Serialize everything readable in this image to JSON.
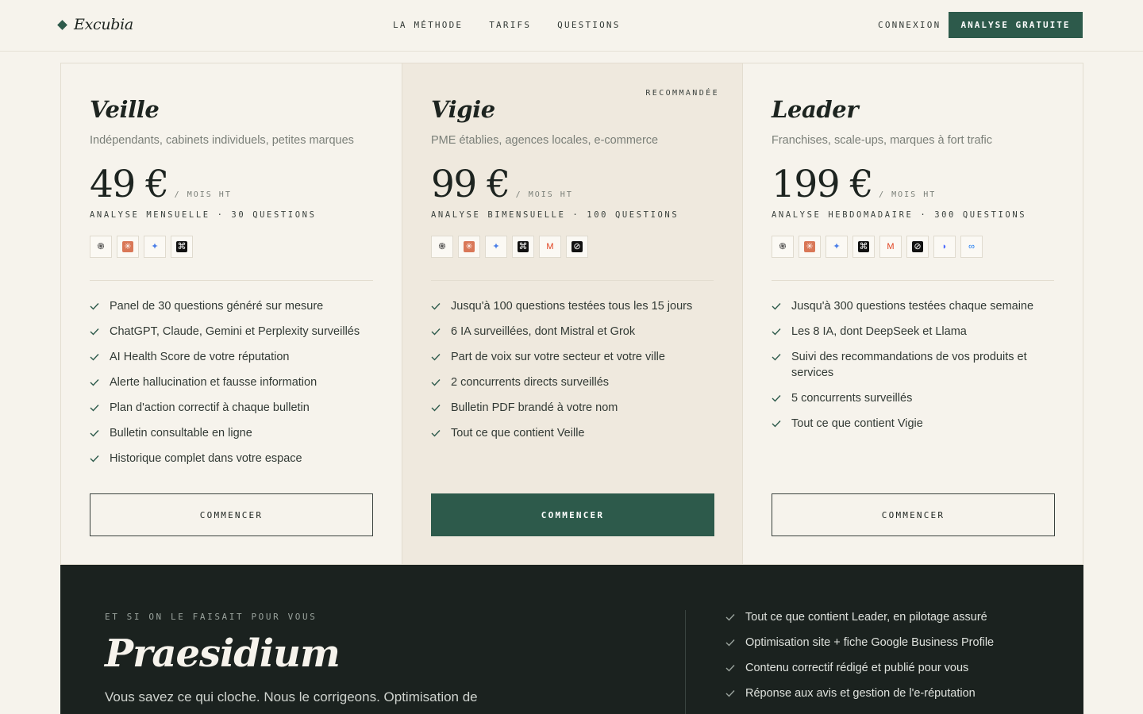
{
  "nav": {
    "brand": "Excubia",
    "links": [
      "LA MÉTHODE",
      "TARIFS",
      "QUESTIONS"
    ],
    "login": "CONNEXION",
    "cta": "ANALYSE GRATUITE"
  },
  "plans": [
    {
      "title": "Veille",
      "subtitle": "Indépendants, cabinets individuels, petites marques",
      "price": "49 €",
      "per": "/ MOIS HT",
      "frequency": "ANALYSE MENSUELLE · 30 QUESTIONS",
      "icons": [
        "chatgpt-icon",
        "claude-icon",
        "gemini-icon",
        "perplexity-icon"
      ],
      "features": [
        "Panel de 30 questions généré sur mesure",
        "ChatGPT, Claude, Gemini et Perplexity surveillés",
        "AI Health Score de votre réputation",
        "Alerte hallucination et fausse information",
        "Plan d'action correctif à chaque bulletin",
        "Bulletin consultable en ligne",
        "Historique complet dans votre espace"
      ],
      "cta": "COMMENCER"
    },
    {
      "title": "Vigie",
      "badge": "RECOMMANDÉE",
      "subtitle": "PME établies, agences locales, e-commerce",
      "price": "99 €",
      "per": "/ MOIS HT",
      "frequency": "ANALYSE BIMENSUELLE · 100 QUESTIONS",
      "icons": [
        "chatgpt-icon",
        "claude-icon",
        "gemini-icon",
        "perplexity-icon",
        "mistral-icon",
        "grok-icon"
      ],
      "features": [
        "Jusqu'à 100 questions testées tous les 15 jours",
        "6 IA surveillées, dont Mistral et Grok",
        "Part de voix sur votre secteur et votre ville",
        "2 concurrents directs surveillés",
        "Bulletin PDF brandé à votre nom",
        "Tout ce que contient Veille"
      ],
      "cta": "COMMENCER"
    },
    {
      "title": "Leader",
      "subtitle": "Franchises, scale-ups, marques à fort trafic",
      "price": "199 €",
      "per": "/ MOIS HT",
      "frequency": "ANALYSE HEBDOMADAIRE · 300 QUESTIONS",
      "icons": [
        "chatgpt-icon",
        "claude-icon",
        "gemini-icon",
        "perplexity-icon",
        "mistral-icon",
        "grok-icon",
        "deepseek-icon",
        "meta-llama-icon"
      ],
      "features": [
        "Jusqu'à 300 questions testées chaque semaine",
        "Les 8 IA, dont DeepSeek et Llama",
        "Suivi des recommandations de vos produits et services",
        "5 concurrents surveillés",
        "Tout ce que contient Vigie"
      ],
      "cta": "COMMENCER"
    }
  ],
  "praesidium": {
    "eyebrow": "ET SI ON LE FAISAIT POUR VOUS",
    "title": "Praesidium",
    "lede": "Vous savez ce qui cloche. Nous le corrigeons. Optimisation de",
    "features": [
      "Tout ce que contient Leader, en pilotage assuré",
      "Optimisation site + fiche Google Business Profile",
      "Contenu correctif rédigé et publié pour vous",
      "Réponse aux avis et gestion de l'e-réputation"
    ]
  },
  "colors": {
    "accent": "#2d5a4b",
    "background": "#f6f3ec",
    "featured": "#efe9de",
    "dark": "#1b221f"
  }
}
